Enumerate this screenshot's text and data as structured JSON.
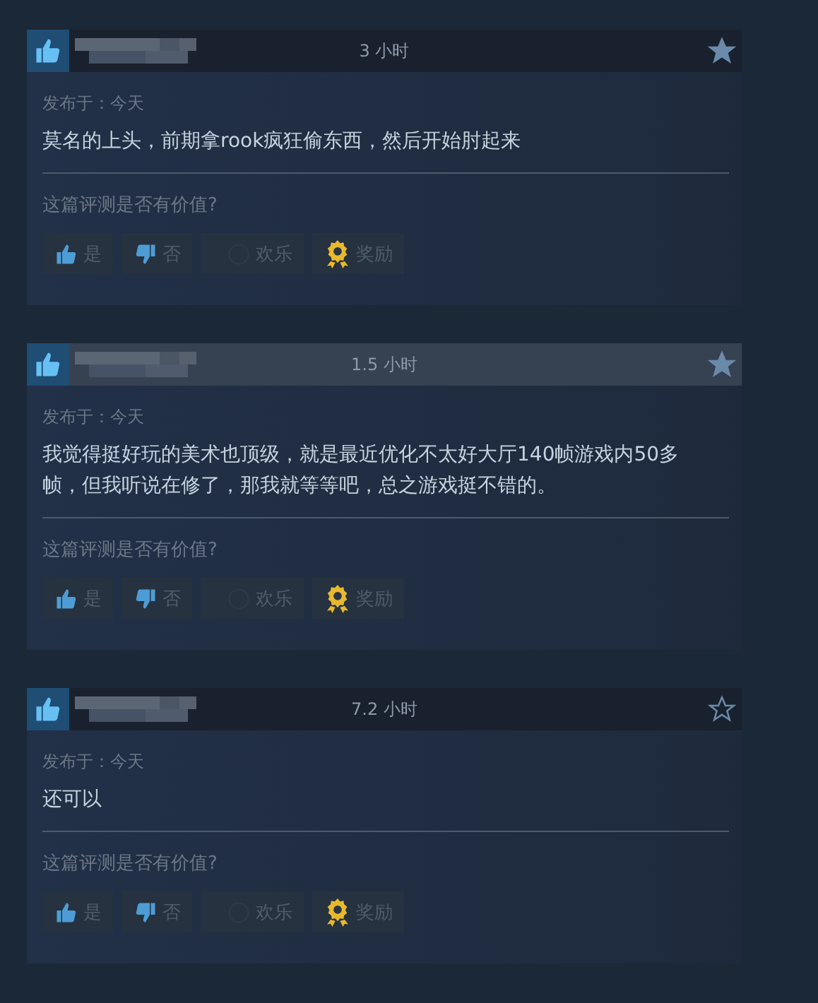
{
  "reviews": [
    {
      "recommended": true,
      "playtime": "3 小时",
      "favorited": true,
      "highlighted": false,
      "posted": "发布于：今天",
      "text": "莫名的上头，前期拿rook疯狂偷东西，然后开始肘起来",
      "question": "这篇评测是否有价值?",
      "buttons": [
        {
          "kind": "yes",
          "label": "是"
        },
        {
          "kind": "no",
          "label": "否"
        },
        {
          "kind": "funny",
          "label": "欢乐"
        },
        {
          "kind": "award",
          "label": "奖励"
        }
      ]
    },
    {
      "recommended": true,
      "playtime": "1.5 小时",
      "favorited": true,
      "highlighted": true,
      "posted": "发布于：今天",
      "text": "我觉得挺好玩的美术也顶级，就是最近优化不太好大厅140帧游戏内50多帧，但我听说在修了，那我就等等吧，总之游戏挺不错的。",
      "question": "这篇评测是否有价值?",
      "buttons": [
        {
          "kind": "yes",
          "label": "是"
        },
        {
          "kind": "no",
          "label": "否"
        },
        {
          "kind": "funny",
          "label": "欢乐"
        },
        {
          "kind": "award",
          "label": "奖励"
        }
      ]
    },
    {
      "recommended": true,
      "playtime": "7.2 小时",
      "favorited": false,
      "highlighted": false,
      "posted": "发布于：今天",
      "text": "还可以",
      "question": "这篇评测是否有价值?",
      "buttons": [
        {
          "kind": "yes",
          "label": "是"
        },
        {
          "kind": "no",
          "label": "否"
        },
        {
          "kind": "funny",
          "label": "欢乐"
        },
        {
          "kind": "award",
          "label": "奖励"
        }
      ]
    }
  ]
}
